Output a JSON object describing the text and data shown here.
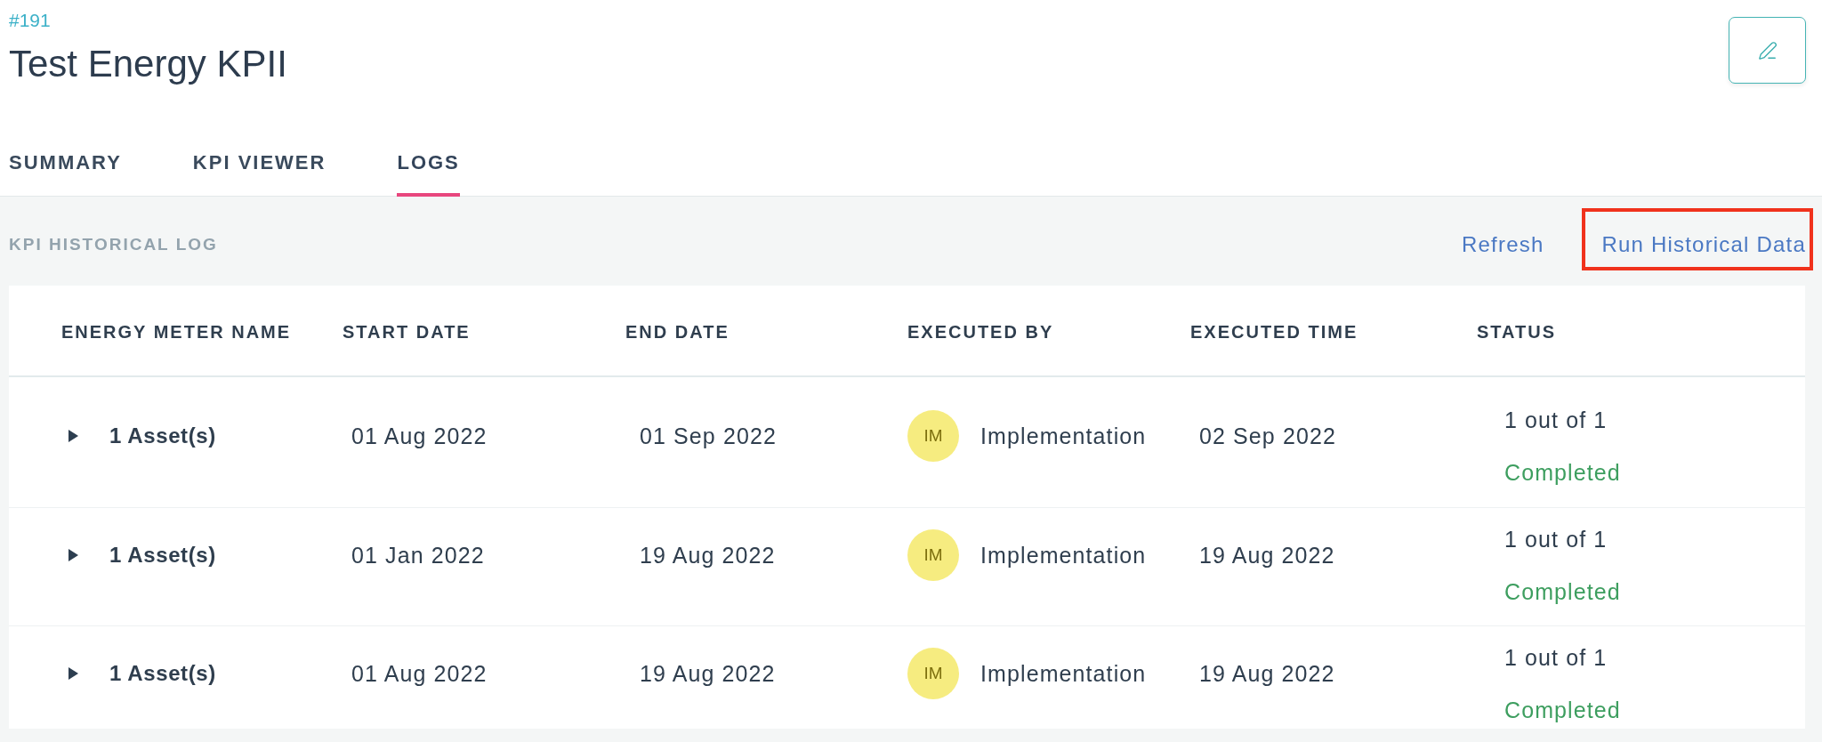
{
  "record": {
    "id": "#191",
    "title": "Test Energy KPII"
  },
  "tabs": [
    {
      "label": "SUMMARY",
      "selected": false
    },
    {
      "label": "KPI VIEWER",
      "selected": false
    },
    {
      "label": "LOGS",
      "selected": true
    }
  ],
  "log_section": {
    "title": "KPI HISTORICAL LOG",
    "actions": [
      {
        "label": "Refresh",
        "highlighted": false
      },
      {
        "label": "Run Historical Data",
        "highlighted": true
      }
    ]
  },
  "table": {
    "columns": [
      "ENERGY METER NAME",
      "START DATE",
      "END DATE",
      "EXECUTED BY",
      "EXECUTED TIME",
      "STATUS"
    ],
    "rows": [
      {
        "energy_meter_name": "1 Asset(s)",
        "expanded": false,
        "start_date": "01 Aug 2022",
        "end_date": "01 Sep 2022",
        "executed_by": {
          "initials": "IM",
          "name": "Implementation"
        },
        "executed_time": "02 Sep 2022",
        "status": {
          "count": "1 out of 1",
          "label": "Completed"
        }
      },
      {
        "energy_meter_name": "1 Asset(s)",
        "expanded": false,
        "start_date": "01 Jan 2022",
        "end_date": "19 Aug 2022",
        "executed_by": {
          "initials": "IM",
          "name": "Implementation"
        },
        "executed_time": "19 Aug 2022",
        "status": {
          "count": "1 out of 1",
          "label": "Completed"
        }
      },
      {
        "energy_meter_name": "1 Asset(s)",
        "expanded": false,
        "start_date": "01 Aug 2022",
        "end_date": "19 Aug 2022",
        "executed_by": {
          "initials": "IM",
          "name": "Implementation"
        },
        "executed_time": "19 Aug 2022",
        "status": {
          "count": "1 out of 1",
          "label": "Completed"
        }
      }
    ]
  }
}
